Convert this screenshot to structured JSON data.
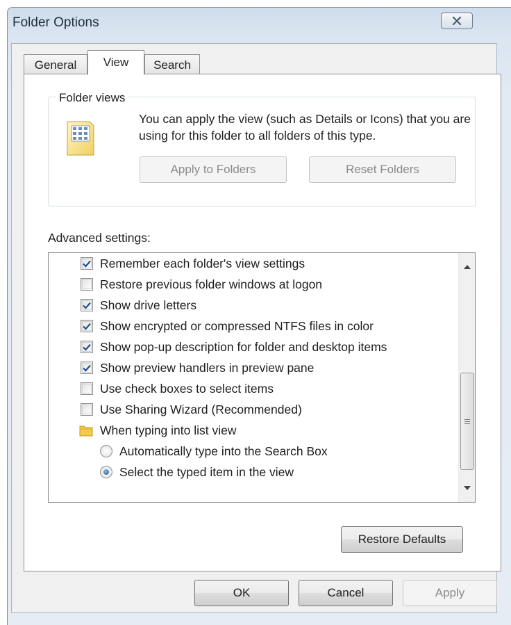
{
  "window": {
    "title": "Folder Options"
  },
  "tabs": [
    {
      "label": "General"
    },
    {
      "label": "View",
      "active": true
    },
    {
      "label": "Search"
    }
  ],
  "folder_views": {
    "group_label": "Folder views",
    "description": "You can apply the view (such as Details or Icons) that you are using for this folder to all folders of this type.",
    "apply_button": "Apply to Folders",
    "reset_button": "Reset Folders",
    "icon": "folder-view-icon"
  },
  "advanced": {
    "label": "Advanced settings:",
    "items": [
      {
        "type": "checkbox",
        "label": "Remember each folder's view settings",
        "checked": true
      },
      {
        "type": "checkbox",
        "label": "Restore previous folder windows at logon",
        "checked": false
      },
      {
        "type": "checkbox",
        "label": "Show drive letters",
        "checked": true
      },
      {
        "type": "checkbox",
        "label": "Show encrypted or compressed NTFS files in color",
        "checked": true
      },
      {
        "type": "checkbox",
        "label": "Show pop-up description for folder and desktop items",
        "checked": true
      },
      {
        "type": "checkbox",
        "label": "Show preview handlers in preview pane",
        "checked": true
      },
      {
        "type": "checkbox",
        "label": "Use check boxes to select items",
        "checked": false
      },
      {
        "type": "checkbox",
        "label": "Use Sharing Wizard (Recommended)",
        "checked": false
      },
      {
        "type": "folder",
        "label": "When typing into list view"
      },
      {
        "type": "radio",
        "label": "Automatically type into the Search Box",
        "selected": false
      },
      {
        "type": "radio",
        "label": "Select the typed item in the view",
        "selected": true
      }
    ],
    "restore_button": "Restore Defaults"
  },
  "footer": {
    "ok": "OK",
    "cancel": "Cancel",
    "apply": "Apply"
  },
  "colors": {
    "accent": "#1a5a9c",
    "check": "#1e4f8c",
    "frame": "#dfe8f2"
  }
}
